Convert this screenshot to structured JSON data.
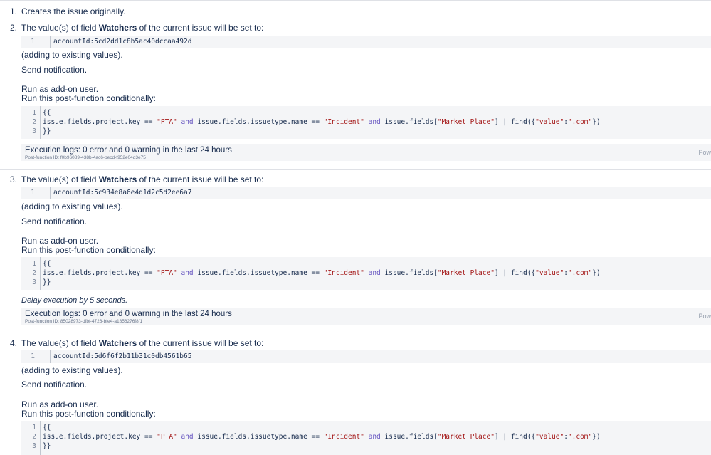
{
  "steps": {
    "s1": {
      "number": "1.",
      "text": "Creates the issue originally."
    },
    "s2": {
      "number": "2.",
      "heading_pre": "The value(s) of field ",
      "heading_field": "Watchers",
      "heading_post": " of the current issue will be set to:",
      "account_line_no": "1",
      "account_value": "accountId:5cd2dd1c8b5ac40dccaa492d",
      "adding": "(adding to existing values).",
      "send": "Send notification.",
      "run_as": "Run as add-on user.",
      "conditional": "Run this post-function conditionally:",
      "log_main": "Execution logs: 0 error and 0 warning in the last 24 hours",
      "log_sub": "Post-function ID: f0b96089-438b-4ac6-becd-f952e04d3e75",
      "log_pow": "Pow"
    },
    "s3": {
      "number": "3.",
      "heading_pre": "The value(s) of field ",
      "heading_field": "Watchers",
      "heading_post": " of the current issue will be set to:",
      "account_line_no": "1",
      "account_value": "accountId:5c934e8a6e4d1d2c5d2ee6a7",
      "adding": "(adding to existing values).",
      "send": "Send notification.",
      "run_as": "Run as add-on user.",
      "conditional": "Run this post-function conditionally:",
      "delay": "Delay execution by 5 seconds.",
      "log_main": "Execution logs: 0 error and 0 warning in the last 24 hours",
      "log_sub": "Post-function ID: 85028973-dfbf-4726-bfe4-a1856276f8f1",
      "log_pow": "Pow"
    },
    "s4": {
      "number": "4.",
      "heading_pre": "The value(s) of field ",
      "heading_field": "Watchers",
      "heading_post": " of the current issue will be set to:",
      "account_line_no": "1",
      "account_value": "accountId:5d6f6f2b11b31c0db4561b65",
      "adding": "(adding to existing values).",
      "send": "Send notification.",
      "run_as": "Run as add-on user.",
      "conditional": "Run this post-function conditionally:"
    }
  },
  "code": {
    "ln1": "1",
    "ln2": "2",
    "ln3": "3",
    "open": "{{",
    "close": "}}",
    "p1": "issue.fields.project.key == ",
    "s_pta": "\"PTA\"",
    "and1": " and ",
    "p2": "issue.fields.issuetype.name == ",
    "s_incident": "\"Incident\"",
    "and2": " and ",
    "p3": "issue.fields[",
    "s_market": "\"Market Place\"",
    "p4": "] | find({",
    "s_value": "\"value\"",
    "colon": ":",
    "s_com": "\".com\"",
    "p5": "})"
  }
}
